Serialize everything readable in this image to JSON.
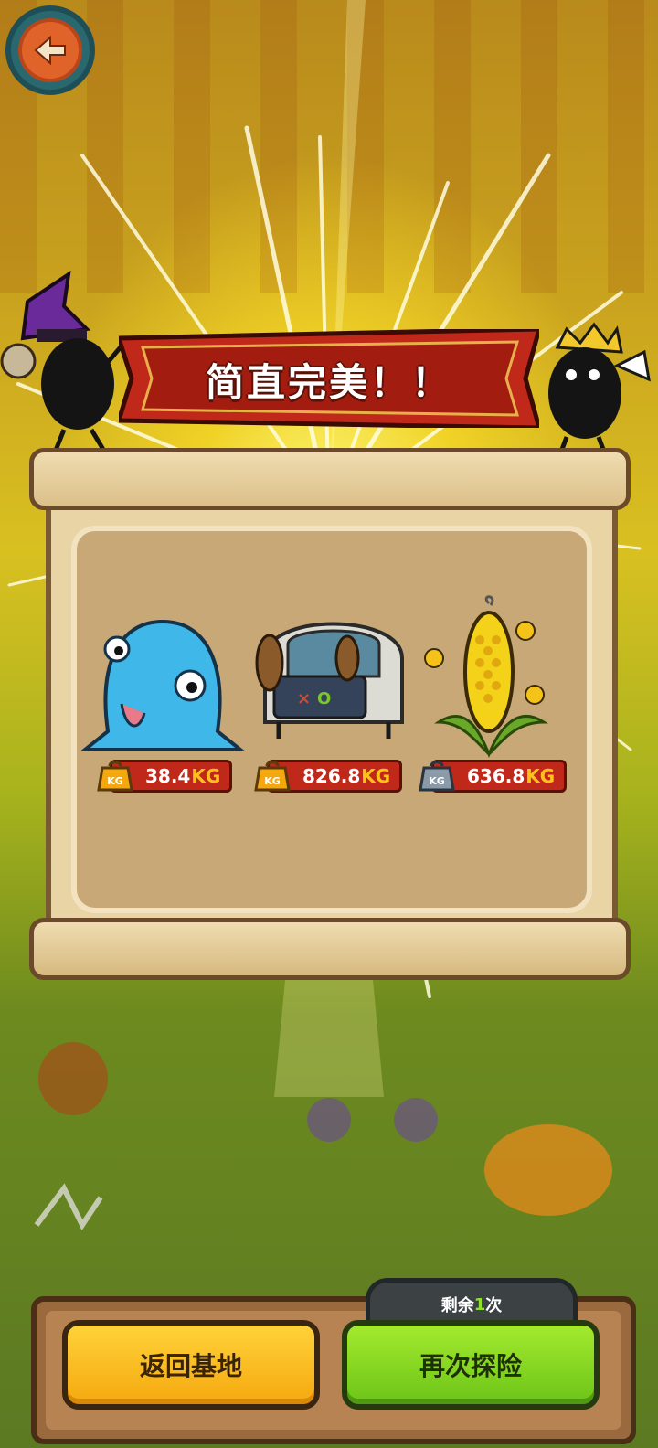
{
  "banner": {
    "title": "简直完美！！"
  },
  "rewards": [
    {
      "name": "blue-slime",
      "weight_value": "38.4",
      "weight_unit": "KG",
      "weight_badge": "gold"
    },
    {
      "name": "treasure-cart",
      "weight_value": "826.8",
      "weight_unit": "KG",
      "weight_badge": "gold"
    },
    {
      "name": "corn-plant",
      "weight_value": "636.8",
      "weight_unit": "KG",
      "weight_badge": "silver"
    }
  ],
  "kg_icon_label": "KG",
  "footer": {
    "remaining_prefix": "剩余",
    "remaining_count": "1",
    "remaining_suffix": "次",
    "home_button": "返回基地",
    "again_button": "再次探险"
  },
  "colors": {
    "banner_red": "#c0281a",
    "gold_badge": "#f5a80e",
    "silver_badge": "#8a9aa8",
    "home_button": "#f5a80e",
    "again_button": "#6cc418"
  }
}
